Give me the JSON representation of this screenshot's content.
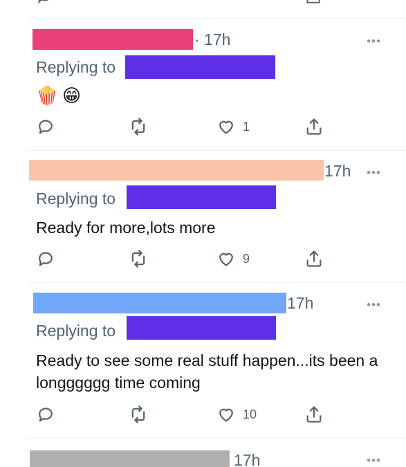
{
  "colors": {
    "redact_pink": "#e8417a",
    "redact_peach": "#fcc3a8",
    "redact_blue": "#6fa6f7",
    "redact_gray": "#b0b0b0",
    "reply_redact": "#5e2ee8",
    "secondary_text": "#536471"
  },
  "tweets": [
    {
      "time": "· 17h",
      "replying_label": "Replying to",
      "body": "",
      "emojis": [
        "🍿",
        "😁"
      ],
      "likes": "1"
    },
    {
      "time": "17h",
      "replying_label": "Replying to",
      "body": "Ready for more,lots more",
      "likes": "9"
    },
    {
      "time": "17h",
      "replying_label": "Replying to",
      "body": "Ready to see some real stuff happen...its been a longggggg time coming",
      "likes": "10"
    },
    {
      "time": "17h"
    }
  ],
  "icons": {
    "reply": "reply-icon",
    "retweet": "retweet-icon",
    "like": "heart-icon",
    "share": "share-icon",
    "more": "more-icon"
  },
  "more_glyph": "•••"
}
